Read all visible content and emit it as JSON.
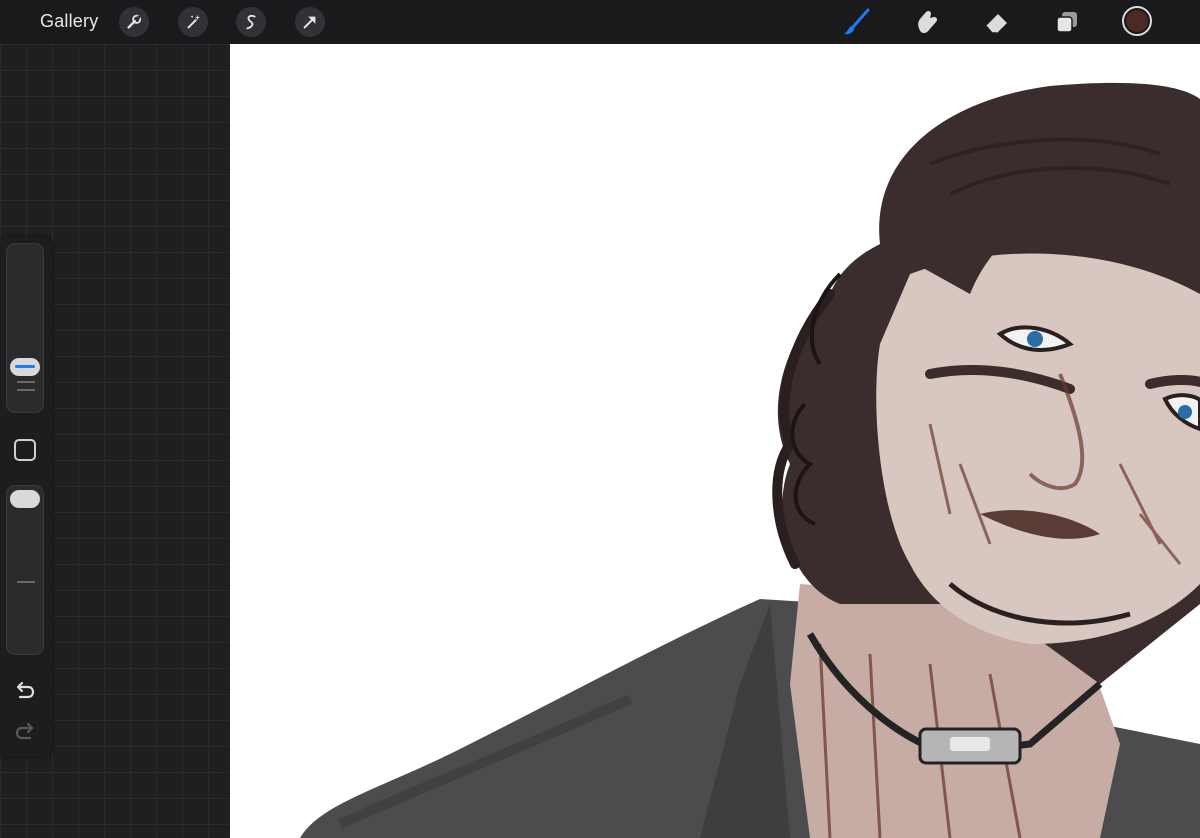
{
  "topbar": {
    "gallery_label": "Gallery",
    "left_tools": [
      "wrench-icon",
      "magic-wand-icon",
      "selection-icon",
      "transform-arrow-icon"
    ],
    "right_tools": [
      "brush-icon",
      "smudge-icon",
      "eraser-icon",
      "layers-icon"
    ],
    "active_tool": "brush",
    "active_tool_color": "#1e7bf5",
    "current_color": "#4a2a22"
  },
  "sidebar": {
    "brush_size_level": 0.25,
    "opacity_level": 1.0,
    "modifier_icon": "square-modifier-icon",
    "undo_icon": "undo-icon",
    "redo_icon": "redo-icon"
  },
  "canvas": {
    "background": "#ffffff",
    "artwork": "digital-painting"
  }
}
